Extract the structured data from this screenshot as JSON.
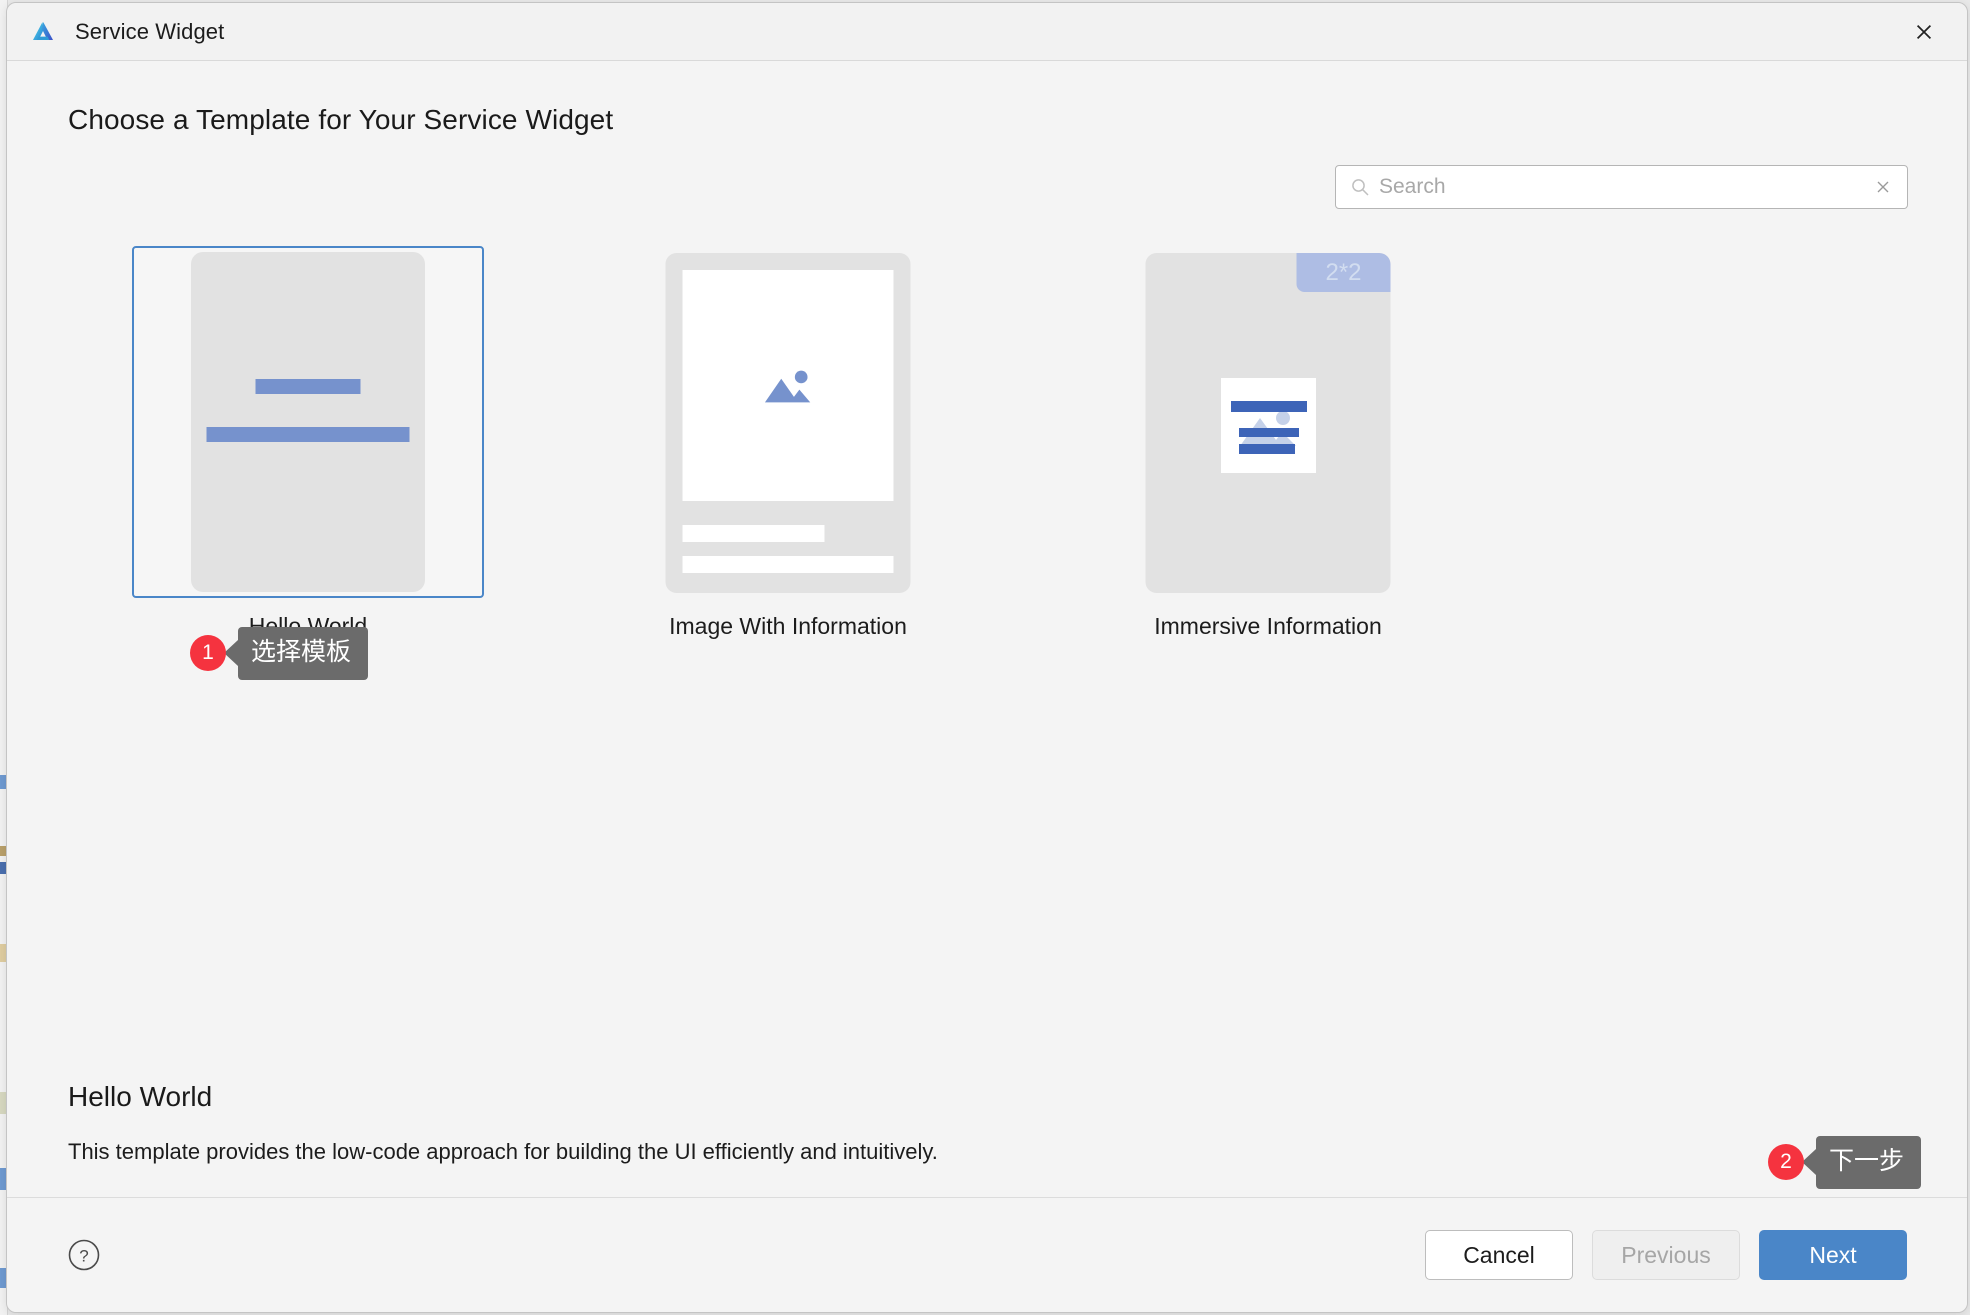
{
  "window": {
    "title": "Service Widget",
    "logo_icon": "deveco-a-logo-icon",
    "close_icon": "close-icon"
  },
  "page": {
    "heading": "Choose a Template for Your Service Widget"
  },
  "search": {
    "icon": "search-icon",
    "placeholder": "Search",
    "value": "",
    "clear_icon": "close-icon",
    "clear_glyph": "✕"
  },
  "templates": [
    {
      "label": "Hello World",
      "selected": true,
      "badge": null
    },
    {
      "label": "Image With Information",
      "selected": false,
      "badge": null
    },
    {
      "label": "Immersive Information",
      "selected": false,
      "badge": "2*2"
    }
  ],
  "tooltips": [
    {
      "number": "1",
      "text": "选择模板"
    },
    {
      "number": "2",
      "text": "下一步"
    }
  ],
  "description": {
    "title": "Hello World",
    "text": "This template provides the low-code approach for building the UI efficiently and intuitively."
  },
  "footer": {
    "help_icon": "question-mark-circle-icon",
    "cancel_label": "Cancel",
    "previous_label": "Previous",
    "next_label": "Next"
  },
  "colors": {
    "accent": "#4a86c8",
    "badge_red": "#f5333f",
    "tooltip_gray": "#6b6b6b",
    "template_blue": "#7692cd",
    "size_badge_blue": "#aebde4",
    "dialog_bg": "#f4f4f4"
  }
}
